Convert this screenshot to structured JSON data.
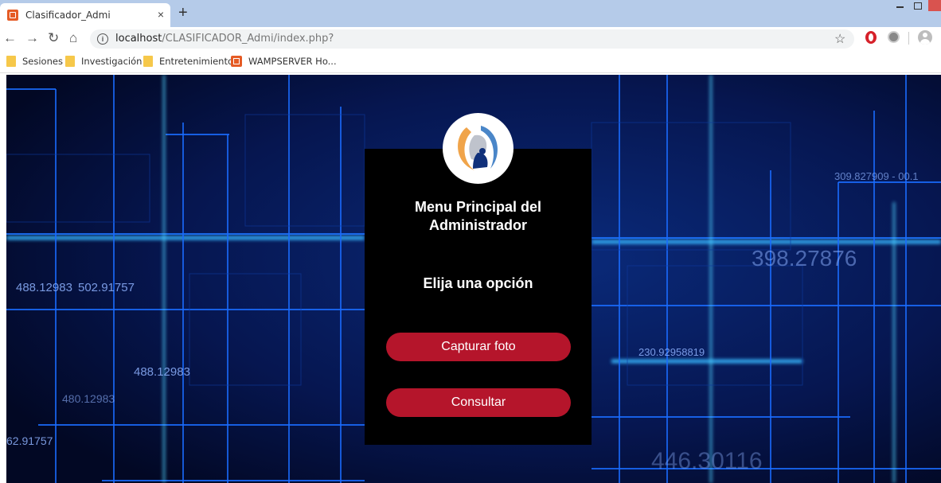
{
  "browser": {
    "tab_title": "Clasificador_Admi",
    "tab_close": "×",
    "new_tab": "+",
    "url_host": "localhost",
    "url_path": "/CLASIFICADOR_Admi/index.php?",
    "nav": {
      "back": "←",
      "forward": "→",
      "reload": "↻",
      "home": "⌂",
      "star": "☆"
    }
  },
  "bookmarks": [
    {
      "label": "Sesiones",
      "icon": "folder-icon"
    },
    {
      "label": "Investigación",
      "icon": "folder-icon"
    },
    {
      "label": "Entretenimiento",
      "icon": "folder-icon"
    },
    {
      "label": "WAMPSERVER Ho...",
      "icon": "wampserver-icon"
    }
  ],
  "background_numbers": [
    "488.12983",
    "502.91757",
    "398.27876",
    "230.92958819",
    "446.30116",
    "62.91757",
    "488.12983",
    "480.12983",
    "309.827909 - 00.1"
  ],
  "menu": {
    "title_line1": "Menu Principal del",
    "title_line2": "Administrador",
    "subtitle": "Elija una opción",
    "capture_button": "Capturar foto",
    "query_button": "Consultar"
  },
  "colors": {
    "tabstrip": "#b5cbe9",
    "page_background": "#030b2a",
    "card": "#000000",
    "button": "#b5152b",
    "neon": "#1e90ff"
  }
}
